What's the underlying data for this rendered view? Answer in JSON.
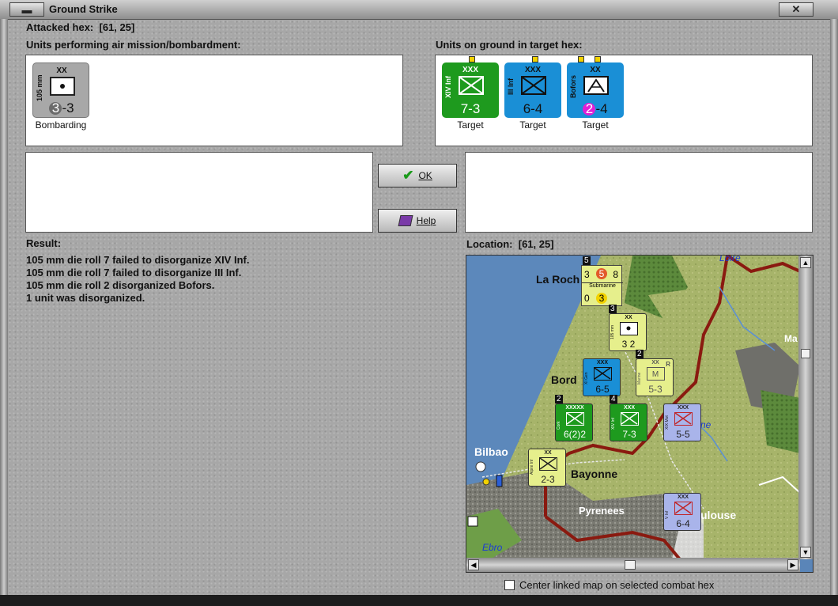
{
  "window": {
    "title": "Ground Strike"
  },
  "attacked_hex": {
    "label": "Attacked hex:",
    "value": "[61, 25]"
  },
  "air_units": {
    "heading": "Units performing air mission/bombardment:",
    "units": [
      {
        "side_text": "105 mm",
        "size": "XX",
        "value_circle": "3",
        "value_rest": "-3",
        "color": "#a8a8a8",
        "caption": "Bombarding"
      }
    ]
  },
  "ground_units": {
    "heading": "Units on ground in target hex:",
    "units": [
      {
        "side_text": "XIV Inf",
        "size": "XXX",
        "value": "7-3",
        "color": "#1e9a1e",
        "caption": "Target"
      },
      {
        "side_text": "III Inf",
        "size": "XXX",
        "value": "6-4",
        "color": "#1a8fd6",
        "caption": "Target"
      },
      {
        "side_text": "Bofors",
        "size": "XX",
        "value_circle": "2",
        "value_rest": "-4",
        "color": "#1a8fd6",
        "caption": "Target"
      }
    ]
  },
  "buttons": {
    "ok": "OK",
    "help": "Help"
  },
  "result": {
    "heading": "Result:",
    "lines": [
      "105 mm die roll 7 failed to disorganize XIV Inf.",
      "105 mm die roll 7 failed to disorganize III Inf.",
      "105 mm die roll 2 disorganized Bofors.",
      "1 unit was disorganized."
    ]
  },
  "location": {
    "label": "Location:",
    "value": "[61, 25]"
  },
  "map": {
    "places": [
      "La Roch",
      "Bord",
      "Bilbao",
      "Bayonne",
      "Pyrenees",
      "ulouse",
      "Loire",
      "Ebro",
      "Ma",
      "ne"
    ],
    "naval_box": {
      "top_left": "3",
      "top_mid": "5",
      "top_right": "8",
      "label": "Submarine",
      "bot_left": "0",
      "bot_mid": "3",
      "stack": "5"
    },
    "counters": [
      {
        "side": "105 mm",
        "size": "XX",
        "value": "3 2",
        "stack": "3"
      },
      {
        "side": "XI Gen",
        "size": "XXX",
        "value": "6-5"
      },
      {
        "side": "Marine",
        "size": "XX",
        "value": "5-3",
        "stack": "2",
        "tag": "R",
        "mark": "M"
      },
      {
        "side": "Cork",
        "size": "XXXXX",
        "value": "6(2)2",
        "stack": "2"
      },
      {
        "side": "XIV Inf",
        "size": "XXX",
        "value": "7-3",
        "stack": "4"
      },
      {
        "side": "XIX Mot",
        "size": "XXX",
        "value": "5-5"
      },
      {
        "side": "Alpini Inf",
        "size": "XX",
        "value": "2-3"
      },
      {
        "side": "V Inf",
        "size": "XXX",
        "value": "6-4"
      }
    ]
  },
  "checkbox": {
    "label": "Center linked map on selected combat hex",
    "checked": false
  },
  "icons": {
    "close": "close-icon",
    "system": "system-menu-icon",
    "ok": "checkmark-icon",
    "help": "help-book-icon"
  }
}
